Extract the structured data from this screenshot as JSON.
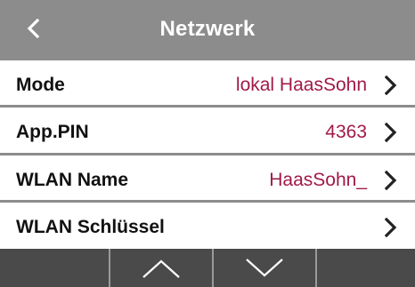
{
  "header": {
    "title": "Netzwerk",
    "back_icon": "chevron-left-icon"
  },
  "rows": [
    {
      "label": "Mode",
      "value": "lokal HaasSohn",
      "icon": "chevron-right-icon"
    },
    {
      "label": "App.PIN",
      "value": "4363",
      "icon": "chevron-right-icon"
    },
    {
      "label": "WLAN Name",
      "value": "HaasSohn_",
      "icon": "chevron-right-icon"
    },
    {
      "label": "WLAN Schlüssel",
      "value": "",
      "icon": "chevron-right-icon"
    }
  ],
  "footer": {
    "buttons": [
      "",
      "chevron-up-icon",
      "chevron-down-icon",
      ""
    ]
  },
  "colors": {
    "header_bg": "#8c8c8c",
    "value_text": "#a11a46",
    "footer_bg": "#4a4a4a",
    "divider": "#9a9a9a"
  }
}
